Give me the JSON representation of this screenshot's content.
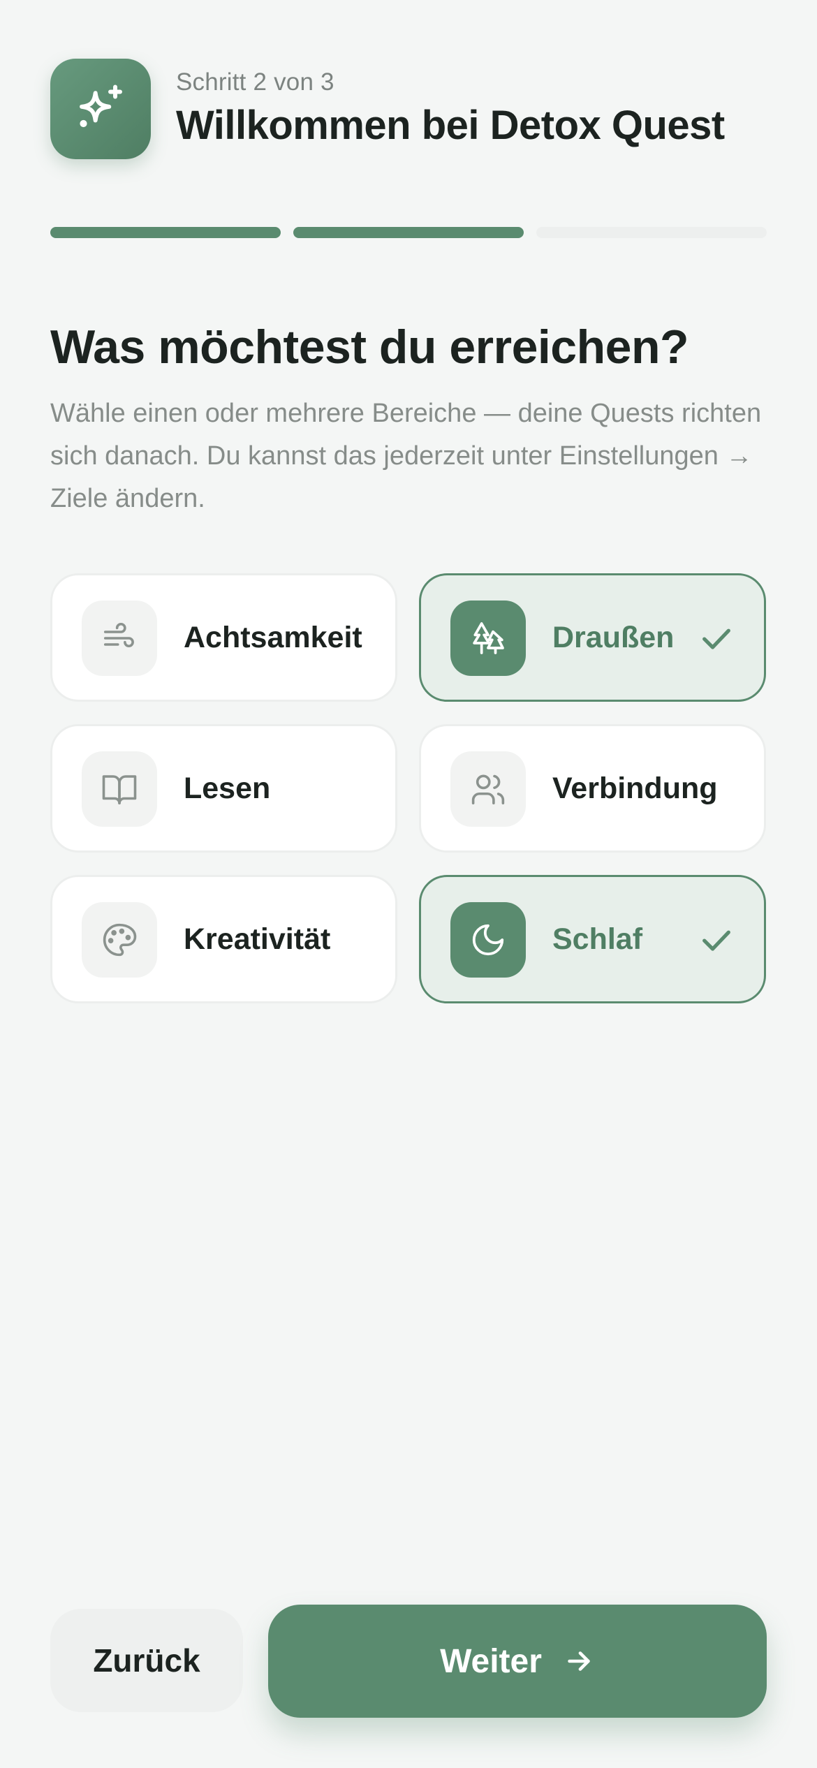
{
  "header": {
    "step": "Schritt 2 von 3",
    "title": "Willkommen bei Detox Quest",
    "app_icon": "sparkles-icon"
  },
  "progress": {
    "current_step": 2,
    "total_steps": 3
  },
  "question": {
    "title": "Was möchtest du erreichen?",
    "subtitle": "Wähle einen oder mehrere Bereiche — deine Quests richten sich danach. Du kannst das jederzeit unter Einstellungen → Ziele ändern."
  },
  "goals": [
    {
      "label": "Achtsamkeit",
      "icon": "wind-icon",
      "selected": false
    },
    {
      "label": "Draußen",
      "icon": "trees-icon",
      "selected": true
    },
    {
      "label": "Lesen",
      "icon": "book-open-icon",
      "selected": false
    },
    {
      "label": "Verbindung",
      "icon": "users-icon",
      "selected": false
    },
    {
      "label": "Kreativität",
      "icon": "palette-icon",
      "selected": false
    },
    {
      "label": "Schlaf",
      "icon": "moon-icon",
      "selected": true
    }
  ],
  "footer": {
    "back_label": "Zurück",
    "next_label": "Weiter"
  },
  "colors": {
    "accent": "#5a8b6f",
    "accent_light": "#e7efea",
    "background": "#f4f6f5",
    "text": "#1c2320",
    "muted": "#868c89"
  }
}
